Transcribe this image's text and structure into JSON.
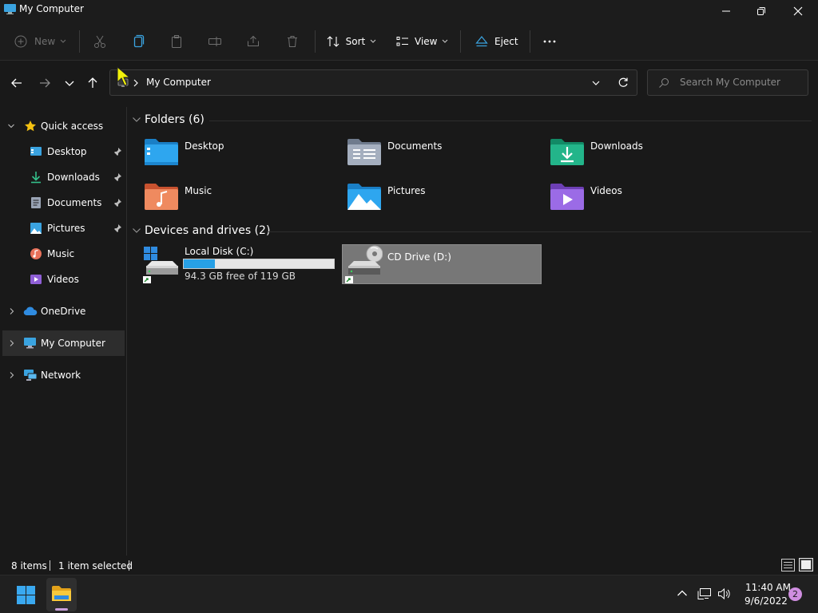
{
  "window": {
    "title": "My Computer"
  },
  "toolbar": {
    "new_label": "New",
    "sort_label": "Sort",
    "view_label": "View",
    "eject_label": "Eject"
  },
  "address": {
    "path": "My Computer",
    "search_placeholder": "Search My Computer"
  },
  "nav": {
    "quick_access": "Quick access",
    "items": [
      {
        "label": "Desktop",
        "pinned": true
      },
      {
        "label": "Downloads",
        "pinned": true
      },
      {
        "label": "Documents",
        "pinned": true
      },
      {
        "label": "Pictures",
        "pinned": true
      },
      {
        "label": "Music",
        "pinned": false
      },
      {
        "label": "Videos",
        "pinned": false
      }
    ],
    "onedrive": "OneDrive",
    "my_computer": "My Computer",
    "network": "Network"
  },
  "folders": {
    "title": "Folders (6)",
    "items": [
      "Desktop",
      "Documents",
      "Downloads",
      "Music",
      "Pictures",
      "Videos"
    ]
  },
  "drives": {
    "title": "Devices and drives (2)",
    "items": [
      {
        "label": "Local Disk (C:)",
        "free_text": "94.3 GB free of 119 GB",
        "used_fraction": 0.21
      },
      {
        "label": "CD Drive (D:)"
      }
    ]
  },
  "status": {
    "items_count": "8 items",
    "selection": "1 item selected"
  },
  "taskbar": {
    "time": "11:40 AM",
    "date": "9/6/2022",
    "notification_count": "2"
  },
  "colors": {
    "accent": "#27a0e6",
    "selected_tile": "#777777",
    "background": "#191919"
  }
}
